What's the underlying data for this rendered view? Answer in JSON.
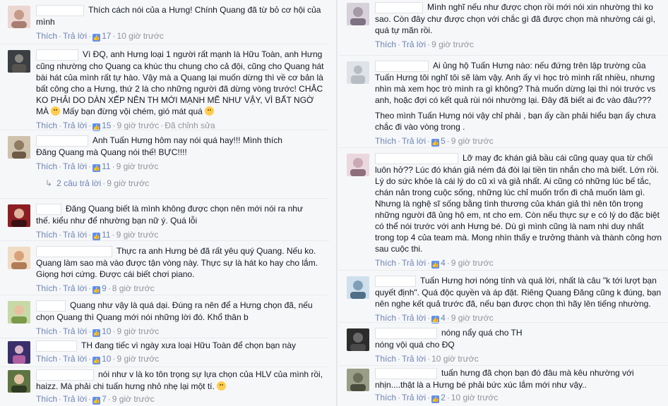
{
  "actions": {
    "like": "Thích",
    "reply": "Trả lời",
    "edited": "Đã chỉnh sửa"
  },
  "left": [
    {
      "text": "Thích cách nói của a Hưng! Chính Quang đã từ bỏ cơ hội của mình",
      "likes": "17",
      "time": "10 giờ trước",
      "avatar": "#e8c9c4"
    },
    {
      "text": "Vì ĐQ, anh Hưng loại 1 người rất mạnh là Hữu Toàn, anh Hưng cũng nhường cho Quang ca khúc thu chung cho cả đội, cũng cho Quang hát bài hát của mình rất tự hào. Vậy mà a Quang lại muốn dừng thì về cơ bản là bất công cho a Hưng, thứ 2 là cho những người đã dừng vòng trước! CHẮC KO PHẢI DO DÀN XẾP NÊN TH MỚI MẠNH MẼ NHƯ VẬY, VÌ BẤT NGỜ MÀ",
      "text_tail": "Mấy bạn đừng vội chém, gió mát quá",
      "likes": "15",
      "time": "9 giờ trước",
      "avatar": "#3b3f44"
    },
    {
      "text": "Anh Tuấn Hưng hôm nay nói quá hay!!! Mình thích Đăng Quang mà Quang nói thế! BỰC!!!!",
      "likes": "11",
      "time": "9 giờ trước",
      "avatar": "#b6a58f"
    },
    {
      "text": "Đăng Quang biết là mình không được chọn nên mới nói ra như thế. kiểu như để nhường bạn nữ ý. Quá lỗi",
      "likes": "11",
      "time": "9 giờ trước",
      "avatar": "#8c1f24"
    },
    {
      "text": "Thực ra anh Hưng bé đã rất yêu quý Quang. Nếu ko. Quang làm sao mà vào được tận vòng này. Thực sự là hát ko hay cho lắm. Giọng hơi cứng. Được cái biết chơi piano.",
      "likes": "9",
      "time": "8 giờ trước",
      "avatar": "#d8b48c"
    },
    {
      "text": "Quang như vậy là quá dại. Đúng ra nên để a Hưng chọn đã, nếu chọn Quang thì Quang mới nói những lời đó. Khổ thân b",
      "likes": "10",
      "time": "9 giờ trước",
      "avatar": "#9fb86a"
    },
    {
      "text": "TH đang tiếc vì ngày xưa loại Hữu Toàn để chọn bạn này",
      "likes": "10",
      "time": "9 giờ trước",
      "avatar": "#3a2f6b"
    },
    {
      "text": "nói như v là ko tôn trọng sự lựa chọn của HLV của mình rồi, haizz. Mà phải chi tuấn hưng nhỏ nhẹ lại một tí.",
      "likes": "7",
      "time": "9 giờ trước",
      "avatar": "#5f7443"
    }
  ],
  "left_replies": "2 câu trả lời",
  "left_replies_time": "9 giờ trước",
  "right": [
    {
      "text": "Mình nghĩ nếu như được chọn rồi mới nói xin nhường thì ko sao. Còn đây chư được chọn với chắc gì đã được chọn mà nhường cái gì, quá tự mãn rồi.",
      "likes": "",
      "time": "9 giờ trước",
      "avatar": "#a49aa8"
    },
    {
      "text": "Ai ủng hộ Tuấn Hưng nào: nếu đứng trên lập trường của Tuấn Hưng tôi nghĩ tôi sẽ làm vậy. Anh ấy vì học trò mình rất nhiều, nhưng nhìn mà xem học trò mình ra gì không? Thà muốn dừng lại thì nói trước vs anh, hoặc đợi có kết quả rùi nói nhường lại. Đây đã biết ai đc vào đâu???",
      "text2": "Theo mình Tuấn Hưng nói vậy chỉ phải , bạn ấy cần phải hiểu bạn ấy chưa chắc đi vào vòng trong .",
      "likes": "5",
      "time": "9 giờ trước",
      "avatar": "#dfe3e8"
    },
    {
      "text": "Lỡ may đc khán giả bầu cái cũng quay qua từ chối luôn hở?? Lúc đó khán giả ném đá đòi lại tiền tin nhắn cho mà biết. Lớn rồi. Lý do sức khỏe là cái lý do cũ xì và giả nhất. Ai cũng có những lúc bế tắc, chán nản trong cuộc sống, những lúc chỉ muốn trốn đi chả muốn làm gì. Nhưng là nghệ sĩ sống bằng tình thương của khán giả thì nên tôn trọng những người đã ủng hộ em, nt cho em. Còn nếu thực sự e có lý do đặc biệt có thể nói trước với anh Hưng bé. Dù gì mình cũng là nam nhi duy nhất trong top 4 của team mà. Mong nhìn thấy e trưởng thành và thành công hơn sau cuộc thi.",
      "likes": "4",
      "time": "9 giờ trước",
      "avatar": "#c9a9b4"
    },
    {
      "text": "Tuấn Hưng hơi nóng tính và quá lời, nhất là câu \"k tới lượt bạn quyết định\". Quá độc quyền và áp đặt. Riêng Quang Đăng cũng k đúng, bạn nên nghe kết quả trước đã, nếu bạn được chọn thì hãy lên tiếng nhường.",
      "likes": "4",
      "time": "9 giờ trước",
      "avatar": "#7f9fb8"
    },
    {
      "text": "nóng nẩy quá cho TH",
      "text2": "nóng vội quá cho ĐQ",
      "likes": "",
      "time": "10 giờ trước",
      "avatar": "#2c2c2c"
    },
    {
      "text": "tuấn hưng đã chọn bạn đó đâu mà kêu nhường với nhịn....thật là a Hưng bé phải bức xúc lắm mới như vậy..",
      "likes": "2",
      "time": "10 giờ trước",
      "avatar": "#6b6f5a"
    }
  ]
}
